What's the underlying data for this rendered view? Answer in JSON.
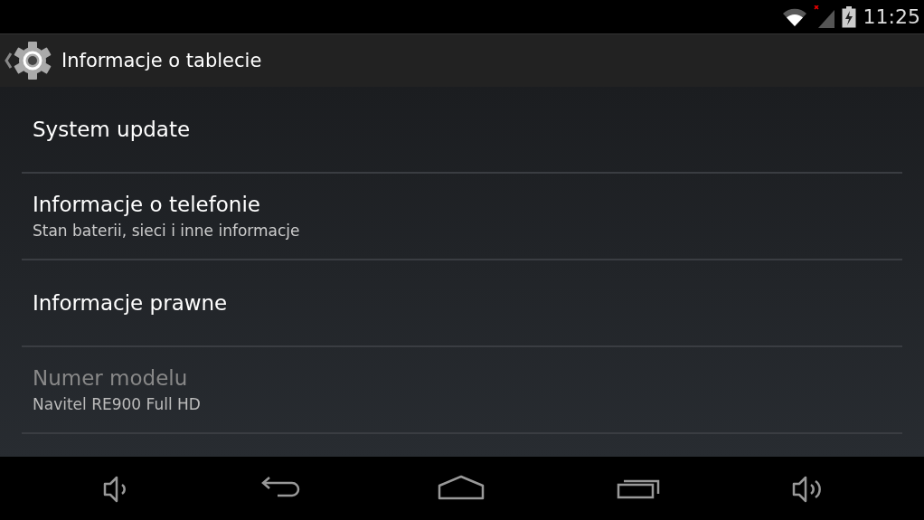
{
  "status_bar": {
    "time": "11:25"
  },
  "action_bar": {
    "title": "Informacje o tablecie"
  },
  "settings": [
    {
      "title": "System update",
      "disabled": false
    },
    {
      "title": "Informacje o telefonie",
      "summary": "Stan baterii, sieci i inne informacje",
      "disabled": false
    },
    {
      "title": "Informacje prawne",
      "disabled": false
    },
    {
      "title": "Numer modelu",
      "summary": "Navitel RE900 Full HD",
      "disabled": true
    }
  ],
  "nav_bar": [
    {
      "kind": "volume-down"
    },
    {
      "kind": "back"
    },
    {
      "kind": "home"
    },
    {
      "kind": "recents"
    },
    {
      "kind": "volume-up"
    }
  ]
}
